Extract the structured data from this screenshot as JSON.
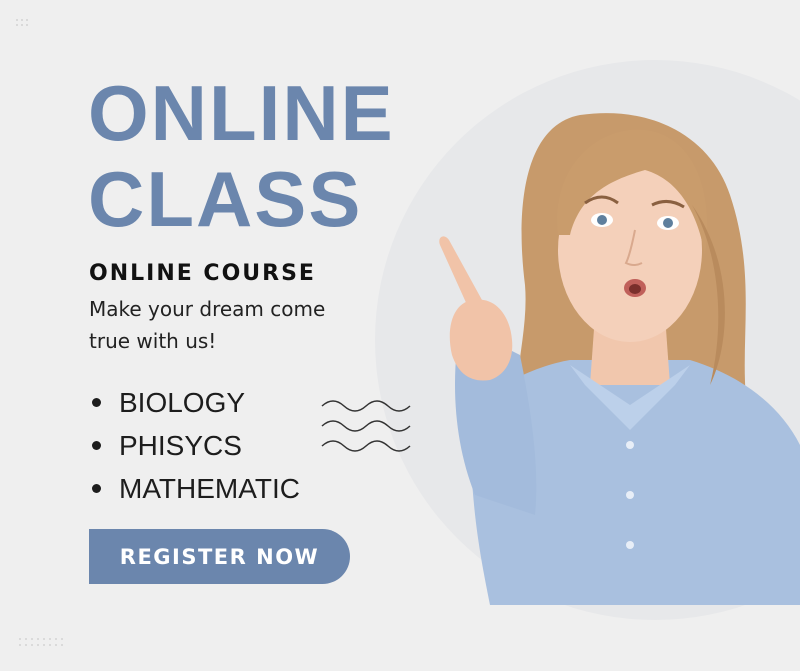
{
  "title": {
    "line1": "ONLINE",
    "line2": "CLASS"
  },
  "subtitle": "ONLINE COURSE",
  "tagline": "Make your dream come true with us!",
  "subjects": [
    "BIOLOGY",
    "PHISYCS",
    "MATHEMATIC"
  ],
  "cta": {
    "label": "REGISTER NOW"
  },
  "colors": {
    "accent": "#6b86ad",
    "background": "#efefef",
    "text": "#1d1d1d"
  },
  "icons": {
    "decor": "wavy-lines-icon",
    "photo": "woman-pointing-up-photo"
  }
}
